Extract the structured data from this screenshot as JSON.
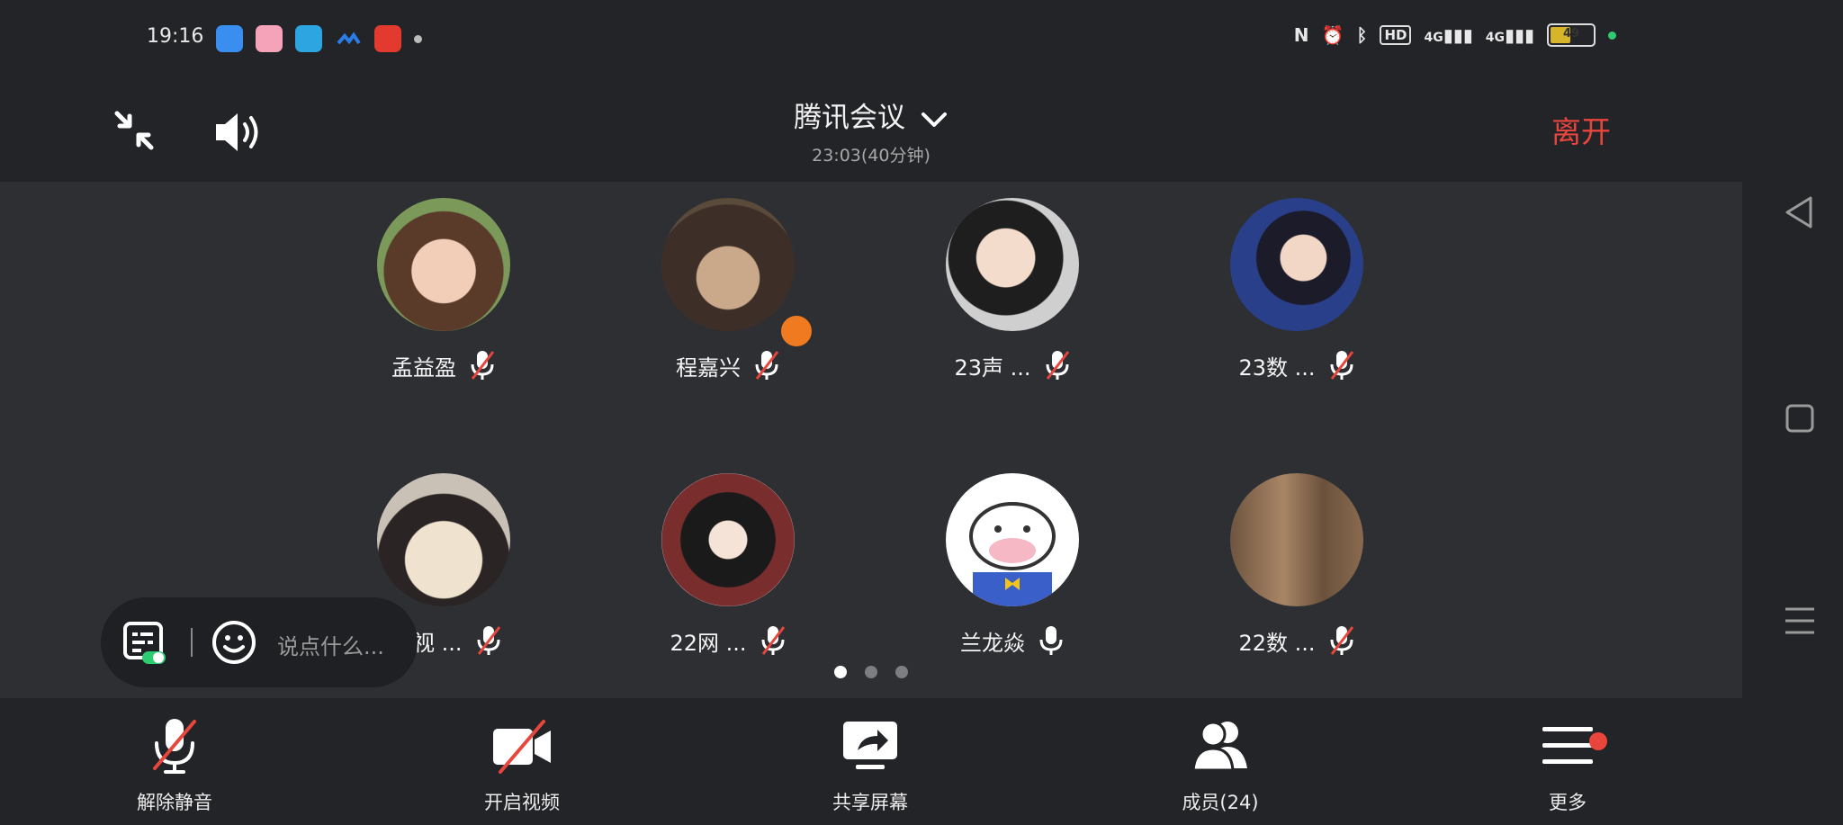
{
  "status_bar": {
    "time": "19:16",
    "network_1": "4G",
    "network_2": "4G",
    "hd_label": "HD",
    "battery": "49"
  },
  "header": {
    "title": "腾讯会议",
    "subtitle": "23:03(40分钟)",
    "leave_label": "离开"
  },
  "participants": [
    {
      "name": "孟益盈",
      "mic": "muted"
    },
    {
      "name": "程嘉兴",
      "mic": "muted",
      "host": true
    },
    {
      "name": "23声 ...",
      "mic": "muted"
    },
    {
      "name": "23数 ...",
      "mic": "muted"
    },
    {
      "name": "22视 ...",
      "mic": "muted"
    },
    {
      "name": "22网 ...",
      "mic": "muted"
    },
    {
      "name": "兰龙焱",
      "mic": "on"
    },
    {
      "name": "22数 ...",
      "mic": "muted"
    }
  ],
  "pager": {
    "pages": 3,
    "current": 1
  },
  "chat": {
    "placeholder": "说点什么..."
  },
  "toolbar": {
    "unmute_label": "解除静音",
    "video_label": "开启视频",
    "share_label": "共享屏幕",
    "members_label": "成员(24)",
    "more_label": "更多"
  },
  "colors": {
    "background": "#232427",
    "stage": "#2d2f33",
    "leave": "#e8453c",
    "mute_slash": "#e8453c",
    "host_badge": "#f07a1f"
  }
}
